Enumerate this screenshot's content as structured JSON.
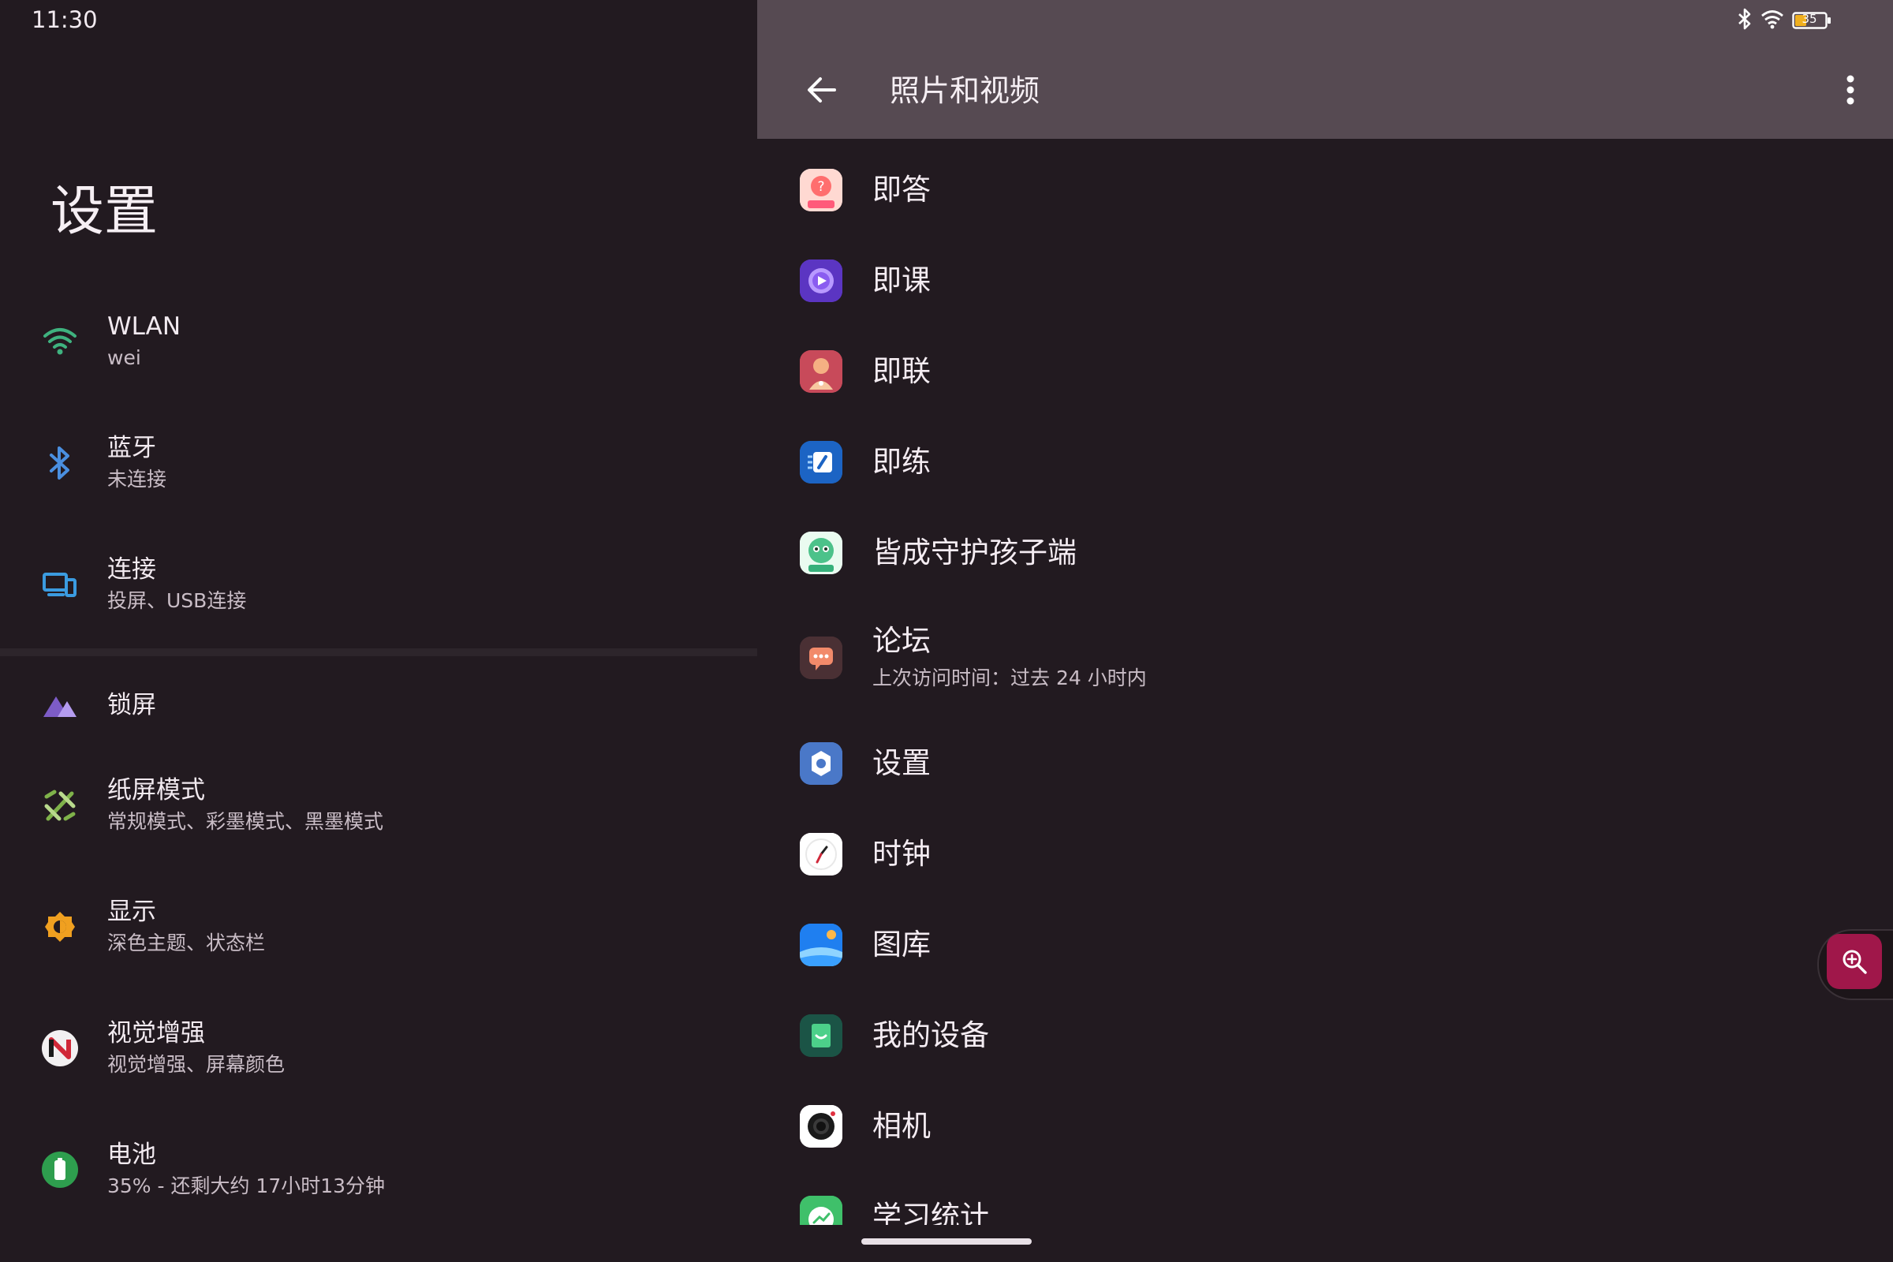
{
  "status": {
    "time": "11:30",
    "battery": "35"
  },
  "left": {
    "title": "设置",
    "items": [
      {
        "label": "WLAN",
        "sub": "wei",
        "icon": "wifi-icon"
      },
      {
        "label": "蓝牙",
        "sub": "未连接",
        "icon": "bluetooth-icon"
      },
      {
        "label": "连接",
        "sub": "投屏、USB连接",
        "icon": "devices-icon"
      },
      {
        "label": "锁屏",
        "sub": "",
        "icon": "lockscreen-icon"
      },
      {
        "label": "纸屏模式",
        "sub": "常规模式、彩墨模式、黑墨模式",
        "icon": "paper-mode-icon"
      },
      {
        "label": "显示",
        "sub": "深色主题、状态栏",
        "icon": "brightness-icon"
      },
      {
        "label": "视觉增强",
        "sub": "视觉增强、屏幕颜色",
        "icon": "visual-enhance-icon"
      },
      {
        "label": "电池",
        "sub": "35% - 还剩大约 17小时13分钟",
        "icon": "battery-icon"
      }
    ]
  },
  "right": {
    "title": "照片和视频",
    "apps": [
      {
        "name": "即答",
        "sub": ""
      },
      {
        "name": "即课",
        "sub": ""
      },
      {
        "name": "即联",
        "sub": ""
      },
      {
        "name": "即练",
        "sub": ""
      },
      {
        "name": "皆成守护孩子端",
        "sub": ""
      },
      {
        "name": "论坛",
        "sub": "上次访问时间：过去 24 小时内"
      },
      {
        "name": "设置",
        "sub": ""
      },
      {
        "name": "时钟",
        "sub": ""
      },
      {
        "name": "图库",
        "sub": ""
      },
      {
        "name": "我的设备",
        "sub": ""
      },
      {
        "name": "相机",
        "sub": ""
      },
      {
        "name": "学习统计",
        "sub": ""
      }
    ]
  },
  "colors": {
    "background": "#221a20",
    "appbar": "#564a52",
    "zoom_button": "#a0174a"
  }
}
